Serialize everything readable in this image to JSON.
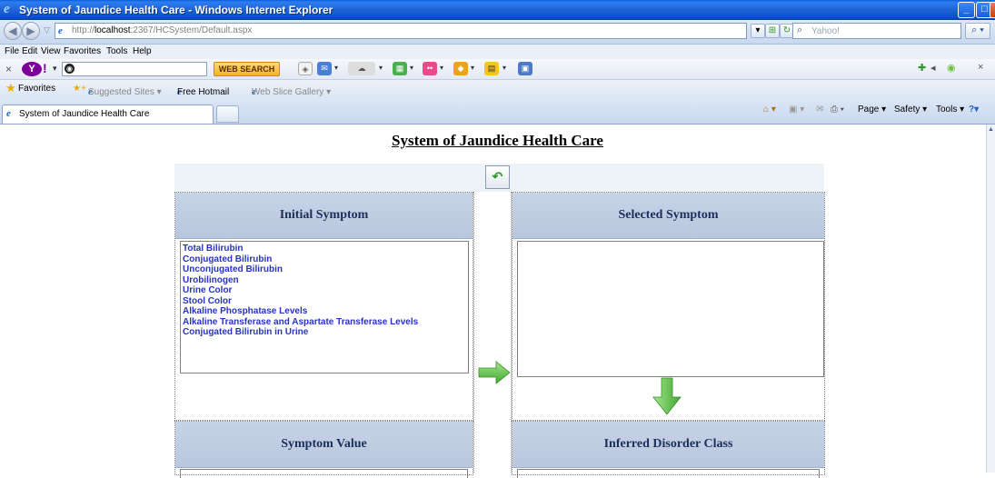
{
  "window": {
    "title": "System of Jaundice Health Care - Windows Internet Explorer"
  },
  "address_bar": {
    "url_prefix": "http://",
    "url_host": "localhost",
    "url_rest": ":2367/HCSystem/Default.aspx",
    "search_placeholder": "Yahoo!"
  },
  "menu": {
    "items": [
      "File",
      "Edit",
      "View",
      "Favorites",
      "Tools",
      "Help"
    ]
  },
  "yahoo_toolbar": {
    "logo": "Y!",
    "search_button": "WEB SEARCH"
  },
  "favorites_bar": {
    "favorites_label": "Favorites",
    "items": [
      "Suggested Sites ▾",
      "Free Hotmail",
      "Web Slice Gallery ▾"
    ]
  },
  "tabs": {
    "active_tab": "System of Jaundice Health Care"
  },
  "command_bar": {
    "page": "Page ▾",
    "safety": "Safety ▾",
    "tools": "Tools ▾"
  },
  "page": {
    "title": "System of Jaundice Health Care",
    "panels": {
      "initial_symptom": {
        "heading": "Initial Symptom",
        "items": [
          "Total Bilirubin",
          "Conjugated Bilirubin",
          "Unconjugated Bilirubin",
          "Urobilinogen",
          "Urine Color",
          "Stool Color",
          "Alkaline Phosphatase Levels",
          "Alkaline Transferase and Aspartate Transferase Levels",
          "Conjugated Bilirubin in Urine"
        ]
      },
      "selected_symptom": {
        "heading": "Selected Symptom",
        "items": []
      },
      "symptom_value": {
        "heading": "Symptom Value"
      },
      "inferred_disorder_class": {
        "heading": "Inferred Disorder Class"
      }
    }
  },
  "colors": {
    "titlebar": "#1f63d6",
    "panel_header": "#c6d2e6",
    "list_text": "#2733c6",
    "arrow_green": "#5cc24a"
  }
}
